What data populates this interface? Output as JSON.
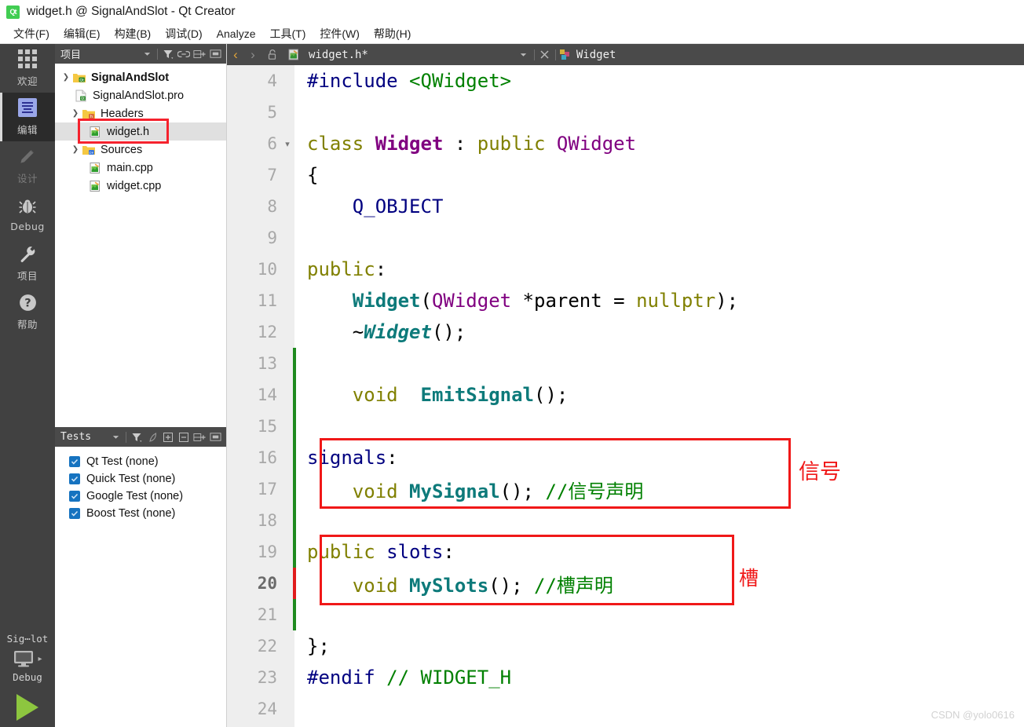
{
  "window": {
    "title": "widget.h @ SignalAndSlot - Qt Creator",
    "logo_text": "Qt"
  },
  "menubar": {
    "items": [
      {
        "label": "文件(F)",
        "name": "menu-file"
      },
      {
        "label": "编辑(E)",
        "name": "menu-edit"
      },
      {
        "label": "构建(B)",
        "name": "menu-build"
      },
      {
        "label": "调试(D)",
        "name": "menu-debug"
      },
      {
        "label": "Analyze",
        "name": "menu-analyze"
      },
      {
        "label": "工具(T)",
        "name": "menu-tools"
      },
      {
        "label": "控件(W)",
        "name": "menu-widgets"
      },
      {
        "label": "帮助(H)",
        "name": "menu-help"
      }
    ]
  },
  "modebar": {
    "items": [
      {
        "label": "欢迎",
        "icon": "grid-icon",
        "state": "normal"
      },
      {
        "label": "编辑",
        "icon": "edit-icon",
        "state": "active"
      },
      {
        "label": "设计",
        "icon": "pencil-icon",
        "state": "disabled"
      },
      {
        "label": "Debug",
        "icon": "bug-icon",
        "state": "normal"
      },
      {
        "label": "项目",
        "icon": "wrench-icon",
        "state": "normal"
      },
      {
        "label": "帮助",
        "icon": "question-icon",
        "state": "normal"
      }
    ],
    "kit_label": "Sig⋯lot",
    "run_config_label": "Debug"
  },
  "project_panel": {
    "title": "项目",
    "toolbar_icons": [
      "chevron-down-icon",
      "filter-icon",
      "link-icon",
      "split-add-icon",
      "minimize-icon"
    ],
    "tree": [
      {
        "label": "SignalAndSlot",
        "depth": 0,
        "chevron": "v",
        "icon": "qt-project-icon",
        "bold": true,
        "selected": false,
        "highlighted": false
      },
      {
        "label": "SignalAndSlot.pro",
        "depth": 1,
        "chevron": "",
        "icon": "pro-file-icon",
        "bold": false,
        "selected": false,
        "highlighted": false
      },
      {
        "label": "Headers",
        "depth": 1,
        "chevron": "v",
        "icon": "folder-h-icon",
        "bold": false,
        "selected": false,
        "highlighted": false
      },
      {
        "label": "widget.h",
        "depth": 2,
        "chevron": "",
        "icon": "source-file-icon",
        "bold": false,
        "selected": true,
        "highlighted": true
      },
      {
        "label": "Sources",
        "depth": 1,
        "chevron": "v",
        "icon": "folder-cpp-icon",
        "bold": false,
        "selected": false,
        "highlighted": false
      },
      {
        "label": "main.cpp",
        "depth": 2,
        "chevron": "",
        "icon": "source-file-icon",
        "bold": false,
        "selected": false,
        "highlighted": false
      },
      {
        "label": "widget.cpp",
        "depth": 2,
        "chevron": "",
        "icon": "source-file-icon",
        "bold": false,
        "selected": false,
        "highlighted": false
      }
    ]
  },
  "tests_panel": {
    "title": "Tests",
    "toolbar_icons": [
      "chevron-down-icon",
      "filter-icon",
      "leaf-icon",
      "expand-all-icon",
      "collapse-all-icon",
      "split-add-icon",
      "minimize-icon"
    ],
    "items": [
      {
        "label": "Qt Test (none)",
        "checked": true
      },
      {
        "label": "Quick Test (none)",
        "checked": true
      },
      {
        "label": "Google Test (none)",
        "checked": true
      },
      {
        "label": "Boost Test (none)",
        "checked": true
      }
    ]
  },
  "editor_tabbar": {
    "back_icon": "chevron-left-icon",
    "forward_icon": "chevron-right-icon",
    "lock_icon": "unlocked-icon",
    "file_icon": "source-file-icon",
    "filename": "widget.h*",
    "dropdown_icon": "chevron-down-icon",
    "close_icon": "close-icon",
    "symbol_icon": "class-icon",
    "symbol": "Widget"
  },
  "code": {
    "lines": [
      {
        "num": "4",
        "fold": "",
        "current": false,
        "change": "",
        "tokens": [
          {
            "t": "#include ",
            "c": "t-pre"
          },
          {
            "t": "<QWidget>",
            "c": "t-inc"
          }
        ]
      },
      {
        "num": "5",
        "fold": "",
        "current": false,
        "change": "",
        "tokens": []
      },
      {
        "num": "6",
        "fold": "▾",
        "current": false,
        "change": "",
        "tokens": [
          {
            "t": "class ",
            "c": "t-kw"
          },
          {
            "t": "Widget",
            "c": "t-cls"
          },
          {
            "t": " : ",
            "c": "t-pun"
          },
          {
            "t": "public",
            "c": "t-kw"
          },
          {
            "t": " ",
            "c": "t-pun"
          },
          {
            "t": "QWidget",
            "c": "t-type"
          }
        ]
      },
      {
        "num": "7",
        "fold": "",
        "current": false,
        "change": "",
        "tokens": [
          {
            "t": "{",
            "c": "t-pun"
          }
        ]
      },
      {
        "num": "8",
        "fold": "",
        "current": false,
        "change": "",
        "tokens": [
          {
            "t": "    Q_OBJECT",
            "c": "t-macro"
          }
        ]
      },
      {
        "num": "9",
        "fold": "",
        "current": false,
        "change": "",
        "tokens": []
      },
      {
        "num": "10",
        "fold": "",
        "current": false,
        "change": "",
        "tokens": [
          {
            "t": "public",
            "c": "t-kw"
          },
          {
            "t": ":",
            "c": "t-pun"
          }
        ]
      },
      {
        "num": "11",
        "fold": "",
        "current": false,
        "change": "",
        "tokens": [
          {
            "t": "    ",
            "c": "t-pun"
          },
          {
            "t": "Widget",
            "c": "t-fn"
          },
          {
            "t": "(",
            "c": "t-pun"
          },
          {
            "t": "QWidget",
            "c": "t-type"
          },
          {
            "t": " *parent ",
            "c": "t-pun"
          },
          {
            "t": "=",
            "c": "t-pun"
          },
          {
            "t": " ",
            "c": "t-pun"
          },
          {
            "t": "nullptr",
            "c": "t-kw"
          },
          {
            "t": ");",
            "c": "t-pun"
          }
        ]
      },
      {
        "num": "12",
        "fold": "",
        "current": false,
        "change": "",
        "tokens": [
          {
            "t": "    ~",
            "c": "t-pun"
          },
          {
            "t": "Widget",
            "c": "t-fni"
          },
          {
            "t": "();",
            "c": "t-pun"
          }
        ]
      },
      {
        "num": "13",
        "fold": "",
        "current": false,
        "change": "green",
        "tokens": []
      },
      {
        "num": "14",
        "fold": "",
        "current": false,
        "change": "green",
        "tokens": [
          {
            "t": "    ",
            "c": "t-pun"
          },
          {
            "t": "void",
            "c": "t-kw"
          },
          {
            "t": "  ",
            "c": "t-pun"
          },
          {
            "t": "EmitSignal",
            "c": "t-fn"
          },
          {
            "t": "();",
            "c": "t-pun"
          }
        ]
      },
      {
        "num": "15",
        "fold": "",
        "current": false,
        "change": "green",
        "tokens": []
      },
      {
        "num": "16",
        "fold": "",
        "current": false,
        "change": "green",
        "tokens": [
          {
            "t": "signals",
            "c": "t-navy"
          },
          {
            "t": ":",
            "c": "t-pun"
          }
        ]
      },
      {
        "num": "17",
        "fold": "",
        "current": false,
        "change": "green",
        "tokens": [
          {
            "t": "    ",
            "c": "t-pun"
          },
          {
            "t": "void",
            "c": "t-kw"
          },
          {
            "t": " ",
            "c": "t-pun"
          },
          {
            "t": "MySignal",
            "c": "t-fn"
          },
          {
            "t": "(); ",
            "c": "t-pun"
          },
          {
            "t": "//信号声明",
            "c": "t-cmt"
          }
        ]
      },
      {
        "num": "18",
        "fold": "",
        "current": false,
        "change": "green",
        "tokens": []
      },
      {
        "num": "19",
        "fold": "",
        "current": false,
        "change": "green",
        "tokens": [
          {
            "t": "public",
            "c": "t-kw"
          },
          {
            "t": " ",
            "c": "t-pun"
          },
          {
            "t": "slots",
            "c": "t-navy"
          },
          {
            "t": ":",
            "c": "t-pun"
          }
        ]
      },
      {
        "num": "20",
        "fold": "",
        "current": true,
        "change": "red",
        "tokens": [
          {
            "t": "    ",
            "c": "t-pun"
          },
          {
            "t": "void",
            "c": "t-kw"
          },
          {
            "t": " ",
            "c": "t-pun"
          },
          {
            "t": "MySlots",
            "c": "t-fn"
          },
          {
            "t": "(); ",
            "c": "t-pun"
          },
          {
            "t": "//槽声明",
            "c": "t-cmt"
          }
        ]
      },
      {
        "num": "21",
        "fold": "",
        "current": false,
        "change": "green",
        "tokens": []
      },
      {
        "num": "22",
        "fold": "",
        "current": false,
        "change": "",
        "tokens": [
          {
            "t": "};",
            "c": "t-pun"
          }
        ]
      },
      {
        "num": "23",
        "fold": "",
        "current": false,
        "change": "",
        "tokens": [
          {
            "t": "#endif",
            "c": "t-pre"
          },
          {
            "t": " ",
            "c": "t-pun"
          },
          {
            "t": "// WIDGET_H",
            "c": "t-cmt"
          }
        ]
      },
      {
        "num": "24",
        "fold": "",
        "current": false,
        "change": "",
        "tokens": []
      }
    ]
  },
  "annotations": [
    {
      "name": "signals-annotation",
      "label": "信号"
    },
    {
      "name": "slots-annotation",
      "label": "槽"
    }
  ],
  "watermark": "CSDN @yolo0616",
  "colors": {
    "annotation_red": "#f01818",
    "accent_green": "#41cd52",
    "selection_gray": "#e0e0e0",
    "panel_dark": "#4a4a4a",
    "modebar_dark": "#414141"
  }
}
